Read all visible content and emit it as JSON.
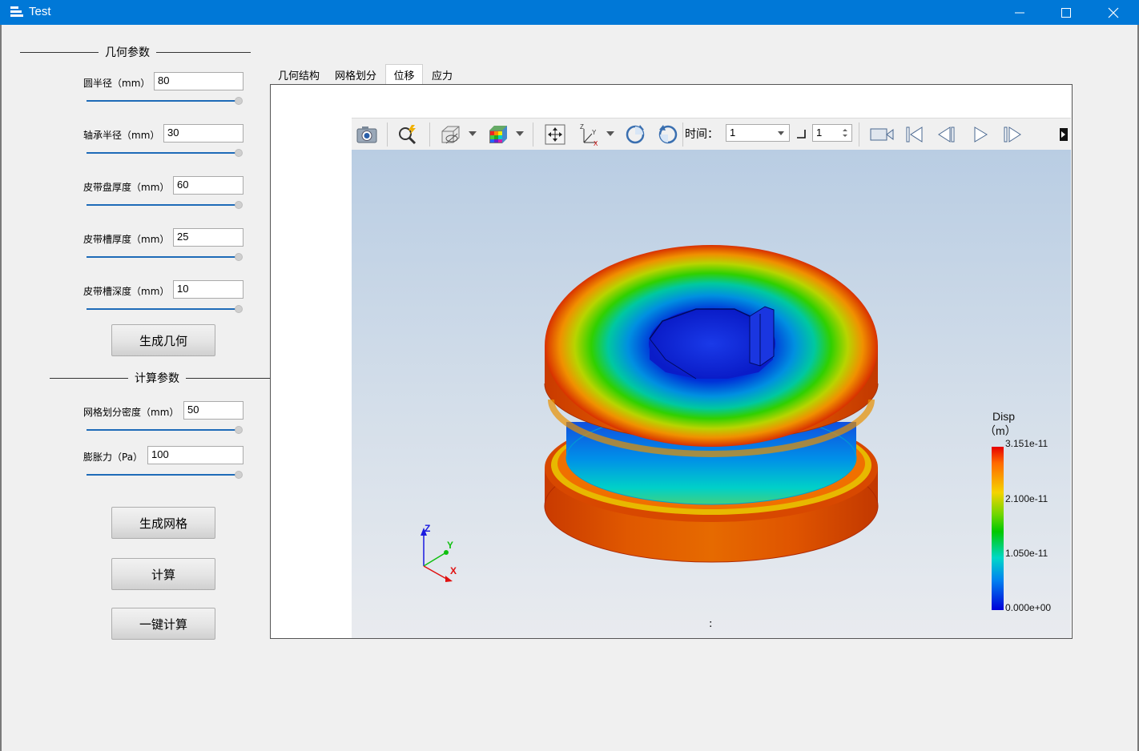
{
  "window": {
    "title": "Test"
  },
  "geometry_group": {
    "title": "几何参数",
    "params": [
      {
        "label": "圆半径（mm）",
        "value": "80"
      },
      {
        "label": "轴承半径（mm）",
        "value": "30"
      },
      {
        "label": "皮带盘厚度（mm）",
        "value": "60"
      },
      {
        "label": "皮带槽厚度（mm）",
        "value": "25"
      },
      {
        "label": "皮带槽深度（mm）",
        "value": "10"
      }
    ],
    "button": "生成几何"
  },
  "compute_group": {
    "title": "计算参数",
    "params": [
      {
        "label": "网格划分密度（mm）",
        "value": "50"
      },
      {
        "label": "膨胀力（Pa）",
        "value": "100"
      }
    ]
  },
  "buttons": {
    "mesh": "生成网格",
    "compute": "计算",
    "one_click": "一键计算"
  },
  "tabs": [
    {
      "label": "几何结构",
      "active": false
    },
    {
      "label": "网格划分",
      "active": false
    },
    {
      "label": "位移",
      "active": true
    },
    {
      "label": "应力",
      "active": false
    }
  ],
  "toolbar": {
    "icons": [
      "camera-icon",
      "zoom-to-data-icon",
      "toggle-visibility-icon",
      "color-map-icon",
      "reset-camera-icon",
      "axes-orientation-icon",
      "rotate-cw-icon",
      "rotate-ccw-icon"
    ],
    "time_label": "时间：",
    "time_value": "1",
    "step_value": "1",
    "playback_icons": [
      "record-icon",
      "first-frame-icon",
      "previous-frame-icon",
      "play-icon",
      "last-frame-icon"
    ]
  },
  "viewer": {
    "legend": {
      "title_line1": "Disp",
      "title_line2": "（m）",
      "ticks": [
        "3.151e-11",
        "2.100e-11",
        "1.050e-11",
        "0.000e+00"
      ]
    },
    "axes": {
      "x": "X",
      "y": "Y",
      "z": "Z"
    },
    "status": ":"
  },
  "colors": {
    "titlebar": "#0078d7",
    "slider": "#1e6bb8"
  }
}
